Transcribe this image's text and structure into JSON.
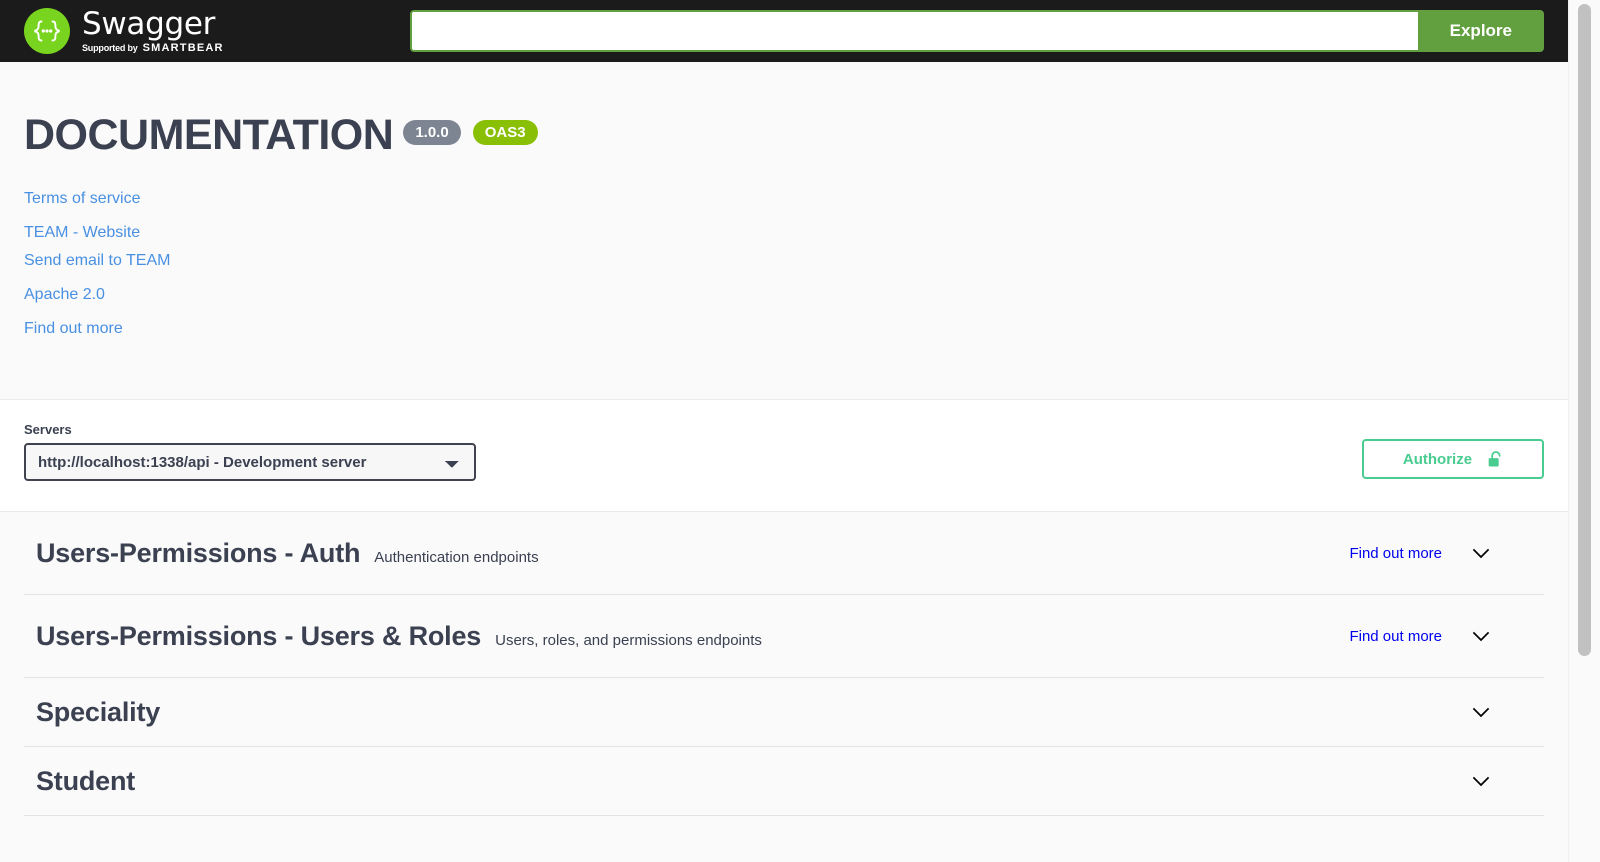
{
  "topbar": {
    "logo_word": "Swagger",
    "logo_supported_by": "Supported by",
    "logo_brand": "SMARTBEAR",
    "logo_icon": "swagger-braces-icon",
    "search_value": "",
    "search_placeholder": "",
    "explore_label": "Explore"
  },
  "info": {
    "title": "DOCUMENTATION",
    "version_badge": "1.0.0",
    "oas_badge": "OAS3",
    "links": [
      {
        "label": "Terms of service",
        "name": "terms-of-service-link"
      },
      {
        "label": "TEAM - Website",
        "name": "team-website-link"
      },
      {
        "label": "Send email to TEAM",
        "name": "contact-email-link"
      },
      {
        "label": "Apache 2.0",
        "name": "license-link"
      },
      {
        "label": "Find out more",
        "name": "external-docs-link"
      }
    ]
  },
  "servers": {
    "label": "Servers",
    "selected": "http://localhost:1338/api - Development server",
    "options": [
      "http://localhost:1338/api - Development server"
    ],
    "authorize_label": "Authorize",
    "authorize_icon": "unlocked-padlock-icon"
  },
  "tags": [
    {
      "name": "Users-Permissions - Auth",
      "description": "Authentication endpoints",
      "external_doc": "Find out more",
      "chevron": "chevron-down-icon"
    },
    {
      "name": "Users-Permissions - Users & Roles",
      "description": "Users, roles, and permissions endpoints",
      "external_doc": "Find out more",
      "chevron": "chevron-down-icon"
    },
    {
      "name": "Speciality",
      "description": "",
      "external_doc": "",
      "chevron": "chevron-down-icon"
    },
    {
      "name": "Student",
      "description": "",
      "external_doc": "",
      "chevron": "chevron-down-icon"
    }
  ],
  "colors": {
    "topbar_bg": "#1b1b1b",
    "explore_green": "#62a03f",
    "logo_green": "#79d41f",
    "oas_green": "#89bf04",
    "version_gray": "#7d8492",
    "authorize_green": "#49cc90",
    "link_blue": "#4990e2",
    "extdoc_blue": "#0000ee",
    "heading_navy": "#3b4151"
  }
}
